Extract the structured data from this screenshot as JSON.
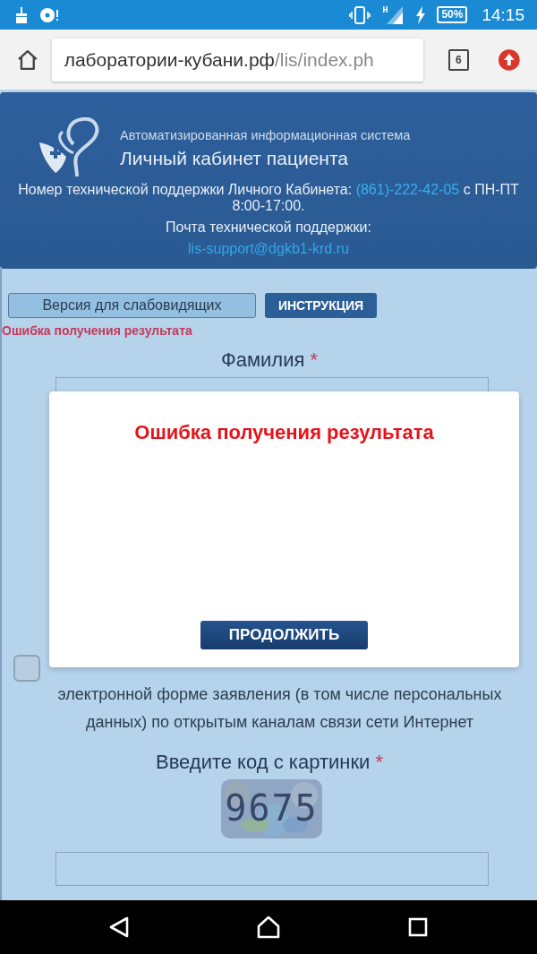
{
  "status_bar": {
    "battery": "50%",
    "time": "14:15"
  },
  "browser": {
    "url_host": "лаборатории-кубани.рф",
    "url_path": "/lis/index.ph",
    "tab_count": "6"
  },
  "header": {
    "subtitle": "Автоматизированная информационная система",
    "title": "Личный кабинет пациента",
    "phone_label": "Номер технической поддержки Личного Кабинета:",
    "phone": "(861)-222-42-05",
    "hours": "с ПН-ПТ 8:00-17:00.",
    "email_label": "Почта технической поддержки:",
    "email": "lis-support@dgkb1-krd.ru"
  },
  "toolbar": {
    "low_vision_button": "Версия для слабовидящих",
    "instruction_button": "ИНСТРУКЦИЯ"
  },
  "error_text": "Ошибка получения результата",
  "form": {
    "surname_label": "Фамилия",
    "required_mark": "*",
    "consent": {
      "checked": false,
      "text": "электронной форме заявления (в том числе персональных данных) по открытым каналам связи сети Интернет"
    },
    "captcha_label": "Введите код с картинки",
    "captcha_required_mark": "*",
    "captcha_code": "9675"
  },
  "dialog": {
    "title": "Ошибка получения результата",
    "button": "ПРОДОЛЖИТЬ"
  }
}
